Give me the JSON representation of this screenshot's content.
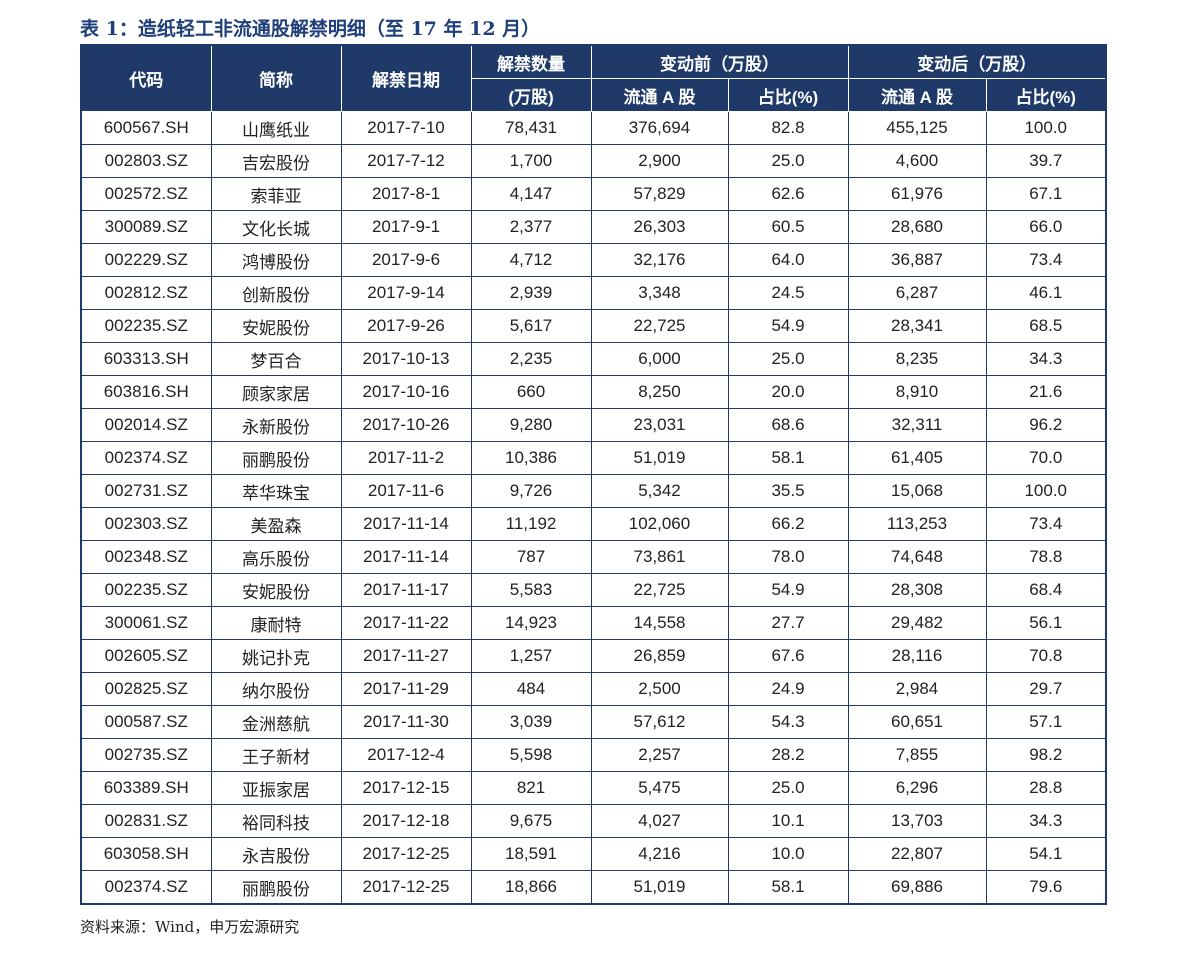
{
  "caption": "表 1：造纸轻工非流通股解禁明细（至 17 年 12 月）",
  "source": "资料来源：Wind，申万宏源研究",
  "headers": {
    "code": "代码",
    "name": "简称",
    "date": "解禁日期",
    "amount_line1": "解禁数量",
    "amount_line2": "(万股)",
    "before_group": "变动前（万股）",
    "after_group": "变动后（万股）",
    "float_a": "流通 A 股",
    "ratio": "占比(%)"
  },
  "rows": [
    [
      "600567.SH",
      "山鹰纸业",
      "2017-7-10",
      "78,431",
      "376,694",
      "82.8",
      "455,125",
      "100.0"
    ],
    [
      "002803.SZ",
      "吉宏股份",
      "2017-7-12",
      "1,700",
      "2,900",
      "25.0",
      "4,600",
      "39.7"
    ],
    [
      "002572.SZ",
      "索菲亚",
      "2017-8-1",
      "4,147",
      "57,829",
      "62.6",
      "61,976",
      "67.1"
    ],
    [
      "300089.SZ",
      "文化长城",
      "2017-9-1",
      "2,377",
      "26,303",
      "60.5",
      "28,680",
      "66.0"
    ],
    [
      "002229.SZ",
      "鸿博股份",
      "2017-9-6",
      "4,712",
      "32,176",
      "64.0",
      "36,887",
      "73.4"
    ],
    [
      "002812.SZ",
      "创新股份",
      "2017-9-14",
      "2,939",
      "3,348",
      "24.5",
      "6,287",
      "46.1"
    ],
    [
      "002235.SZ",
      "安妮股份",
      "2017-9-26",
      "5,617",
      "22,725",
      "54.9",
      "28,341",
      "68.5"
    ],
    [
      "603313.SH",
      "梦百合",
      "2017-10-13",
      "2,235",
      "6,000",
      "25.0",
      "8,235",
      "34.3"
    ],
    [
      "603816.SH",
      "顾家家居",
      "2017-10-16",
      "660",
      "8,250",
      "20.0",
      "8,910",
      "21.6"
    ],
    [
      "002014.SZ",
      "永新股份",
      "2017-10-26",
      "9,280",
      "23,031",
      "68.6",
      "32,311",
      "96.2"
    ],
    [
      "002374.SZ",
      "丽鹏股份",
      "2017-11-2",
      "10,386",
      "51,019",
      "58.1",
      "61,405",
      "70.0"
    ],
    [
      "002731.SZ",
      "萃华珠宝",
      "2017-11-6",
      "9,726",
      "5,342",
      "35.5",
      "15,068",
      "100.0"
    ],
    [
      "002303.SZ",
      "美盈森",
      "2017-11-14",
      "11,192",
      "102,060",
      "66.2",
      "113,253",
      "73.4"
    ],
    [
      "002348.SZ",
      "高乐股份",
      "2017-11-14",
      "787",
      "73,861",
      "78.0",
      "74,648",
      "78.8"
    ],
    [
      "002235.SZ",
      "安妮股份",
      "2017-11-17",
      "5,583",
      "22,725",
      "54.9",
      "28,308",
      "68.4"
    ],
    [
      "300061.SZ",
      "康耐特",
      "2017-11-22",
      "14,923",
      "14,558",
      "27.7",
      "29,482",
      "56.1"
    ],
    [
      "002605.SZ",
      "姚记扑克",
      "2017-11-27",
      "1,257",
      "26,859",
      "67.6",
      "28,116",
      "70.8"
    ],
    [
      "002825.SZ",
      "纳尔股份",
      "2017-11-29",
      "484",
      "2,500",
      "24.9",
      "2,984",
      "29.7"
    ],
    [
      "000587.SZ",
      "金洲慈航",
      "2017-11-30",
      "3,039",
      "57,612",
      "54.3",
      "60,651",
      "57.1"
    ],
    [
      "002735.SZ",
      "王子新材",
      "2017-12-4",
      "5,598",
      "2,257",
      "28.2",
      "7,855",
      "98.2"
    ],
    [
      "603389.SH",
      "亚振家居",
      "2017-12-15",
      "821",
      "5,475",
      "25.0",
      "6,296",
      "28.8"
    ],
    [
      "002831.SZ",
      "裕同科技",
      "2017-12-18",
      "9,675",
      "4,027",
      "10.1",
      "13,703",
      "34.3"
    ],
    [
      "603058.SH",
      "永吉股份",
      "2017-12-25",
      "18,591",
      "4,216",
      "10.0",
      "22,807",
      "54.1"
    ],
    [
      "002374.SZ",
      "丽鹏股份",
      "2017-12-25",
      "18,866",
      "51,019",
      "58.1",
      "69,886",
      "79.6"
    ]
  ]
}
